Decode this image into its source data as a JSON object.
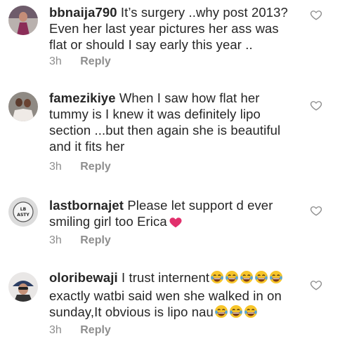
{
  "comments": [
    {
      "username": "bbnaija790",
      "lines": [
        "It’s surgery ..why post 2013?",
        "Even her last year pictures her ass was",
        "flat or should I say early this year .."
      ],
      "time": "3h",
      "reply": "Reply"
    },
    {
      "username": "famezikiye",
      "lines": [
        "When I saw how flat her",
        "tummy is I knew it was definitely lipo",
        "section ...but then again she is beautiful",
        "and it fits her"
      ],
      "time": "3h",
      "reply": "Reply"
    },
    {
      "username": "lastbornajet",
      "lines": [
        "Please let support d ever",
        "smiling girl too Erica"
      ],
      "time": "3h",
      "reply": "Reply",
      "avatar_text": "LB ASTY"
    },
    {
      "username": "oloribewaji",
      "lines": [
        "I trust internent",
        "exactly watbi said wen she walked in on",
        "sunday,It obvious is lipo nau"
      ],
      "time": "3h",
      "reply": "Reply"
    }
  ],
  "icons": {
    "like": "heart-outline-icon",
    "laugh": "face-with-tears-of-joy-icon",
    "pink_heart": "pink-heart-icon"
  },
  "colors": {
    "text": "#262626",
    "meta": "#8e8e8e",
    "emoji_face": "#f7c52a",
    "pink_heart": "#e1306c"
  }
}
